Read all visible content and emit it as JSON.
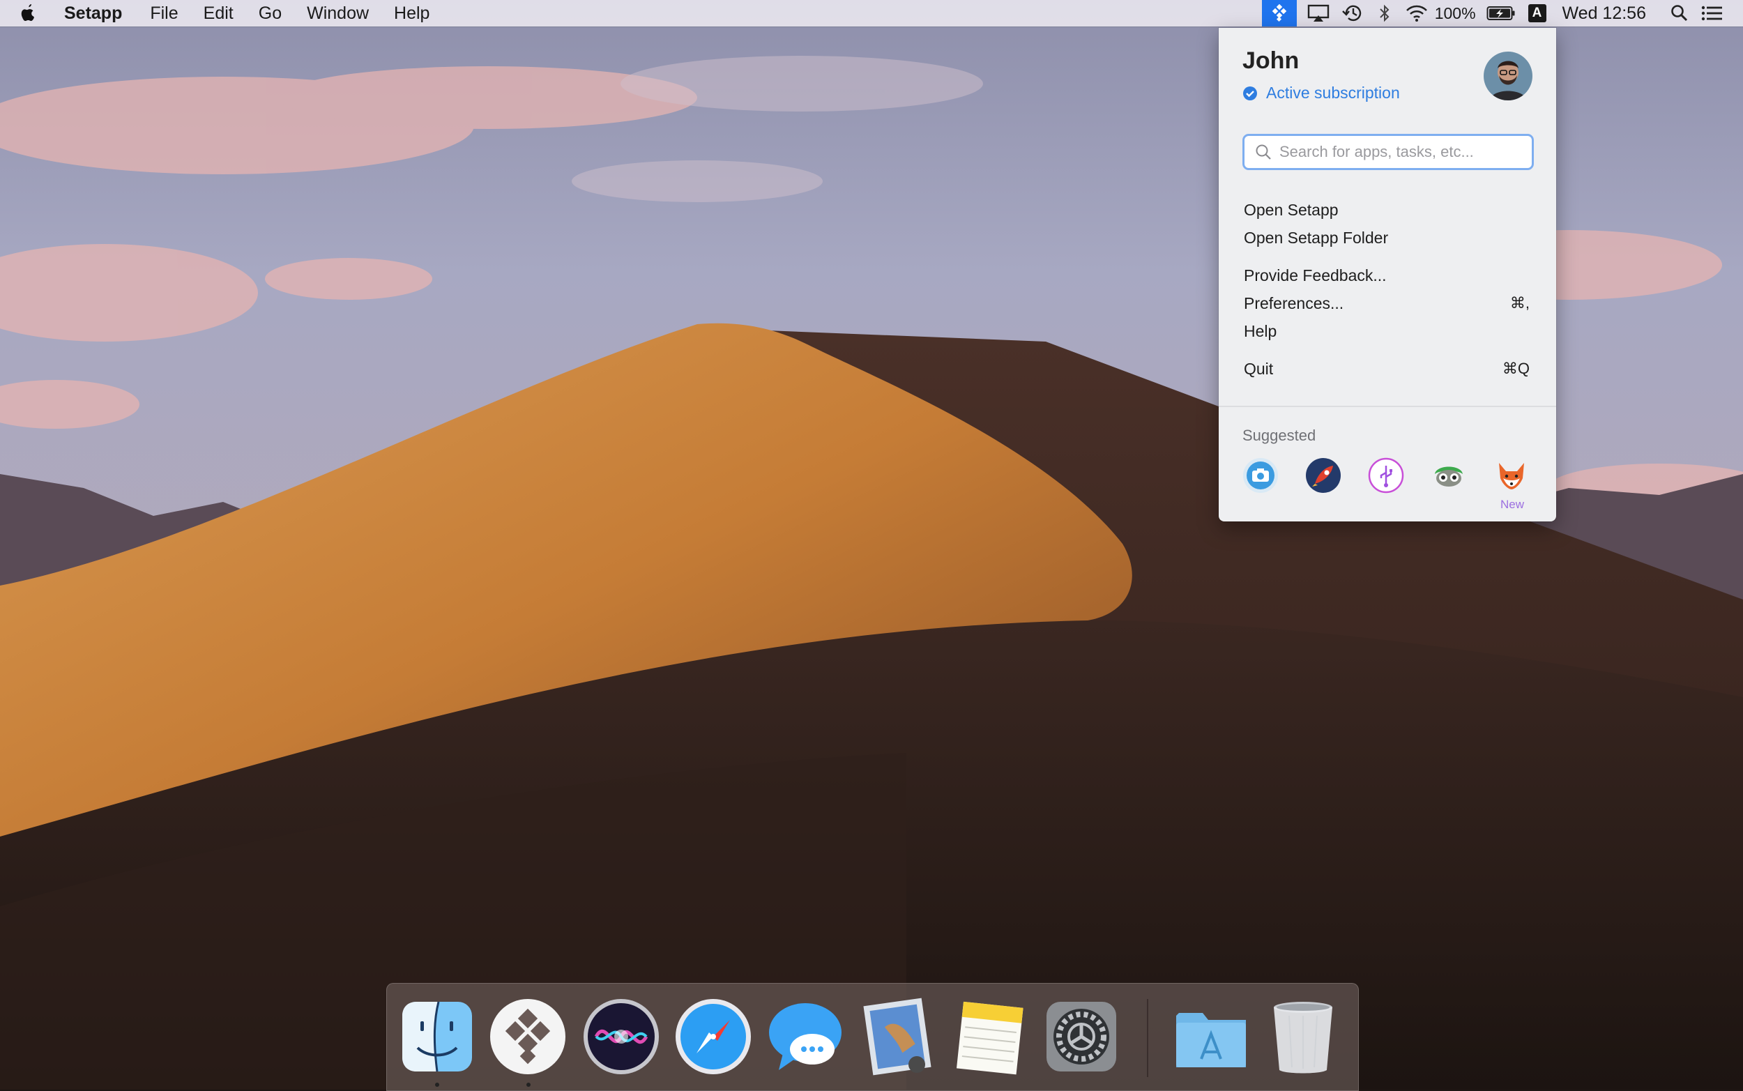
{
  "menubar": {
    "app_name": "Setapp",
    "menus": [
      "File",
      "Edit",
      "Go",
      "Window",
      "Help"
    ],
    "battery": "100%",
    "input_source": "A",
    "clock": "Wed 12:56"
  },
  "popover": {
    "user_name": "John",
    "subscription_status": "Active subscription",
    "search_placeholder": "Search for apps, tasks, etc...",
    "items": [
      {
        "label": "Open Setapp",
        "shortcut": ""
      },
      {
        "label": "Open Setapp Folder",
        "shortcut": ""
      },
      {
        "label": "Provide Feedback...",
        "shortcut": ""
      },
      {
        "label": "Preferences...",
        "shortcut": "⌘,"
      },
      {
        "label": "Help",
        "shortcut": ""
      },
      {
        "label": "Quit",
        "shortcut": "⌘Q"
      }
    ],
    "suggested_label": "Suggested",
    "suggested_new_badge": "New"
  },
  "dock": {
    "apps": [
      "finder-icon",
      "setapp-icon",
      "siri-icon",
      "safari-icon",
      "messages-icon",
      "mail-icon",
      "notes-icon",
      "system-preferences-icon",
      "applications-folder-icon",
      "trash-icon"
    ]
  },
  "colors": {
    "accent": "#1f74ee",
    "subscription": "#2e7de0",
    "new_badge": "#9c6fe0"
  }
}
